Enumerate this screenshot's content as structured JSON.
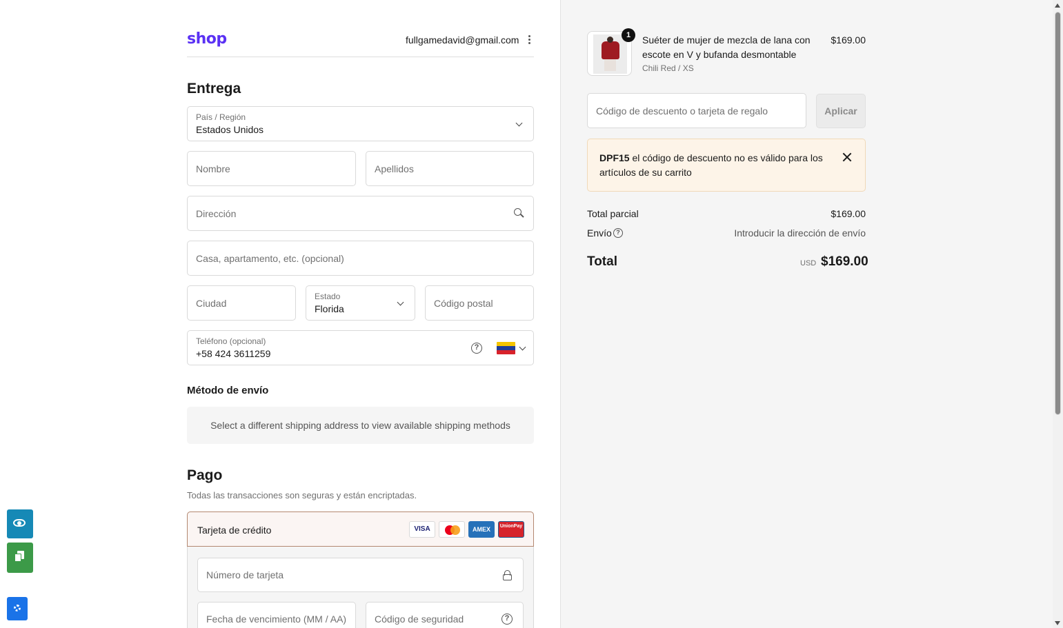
{
  "header": {
    "logo": "shop",
    "email": "fullgamedavid@gmail.com"
  },
  "delivery": {
    "title": "Entrega",
    "country": {
      "label": "País / Región",
      "value": "Estados Unidos"
    },
    "first_name": {
      "placeholder": "Nombre"
    },
    "last_name": {
      "placeholder": "Apellidos"
    },
    "address": {
      "placeholder": "Dirección"
    },
    "apartment": {
      "placeholder": "Casa, apartamento, etc. (opcional)"
    },
    "city": {
      "placeholder": "Ciudad"
    },
    "state": {
      "label": "Estado",
      "value": "Florida"
    },
    "zip": {
      "placeholder": "Código postal"
    },
    "phone": {
      "label": "Teléfono (opcional)",
      "value": "+58 424 3611259",
      "help": "?",
      "flag": "venezuela-flag"
    }
  },
  "shipping": {
    "title": "Método de envío",
    "message": "Select a different shipping address to view available shipping methods"
  },
  "payment": {
    "title": "Pago",
    "subtitle": "Todas las transacciones son seguras y están encriptadas.",
    "method_label": "Tarjeta de crédito",
    "cards": [
      "VISA",
      "mastercard",
      "AMEX",
      "UnionPay"
    ],
    "card_number": {
      "placeholder": "Número de tarjeta"
    },
    "expiry": {
      "placeholder": "Fecha de vencimiento (MM / AA)"
    },
    "cvv": {
      "placeholder": "Código de seguridad",
      "help": "?"
    }
  },
  "summary": {
    "product": {
      "quantity": "1",
      "name": "Suéter de mujer de mezcla de lana con escote en V y bufanda desmontable",
      "variant": "Chili Red / XS",
      "price": "$169.00"
    },
    "discount": {
      "placeholder": "Código de descuento o tarjeta de regalo",
      "apply_label": "Aplicar"
    },
    "alert": {
      "code": "DPF15",
      "message": " el código de descuento no es válido para los artículos de su carrito"
    },
    "subtotal_label": "Total parcial",
    "subtotal_value": "$169.00",
    "shipping_label": "Envío",
    "shipping_help": "?",
    "shipping_value": "Introducir la dirección de envío",
    "total_label": "Total",
    "currency": "USD",
    "total_value": "$169.00"
  },
  "colors": {
    "brand": "#5a31f4",
    "alert_bg": "#fdf4e8",
    "panel_bg": "#f5f5f5"
  }
}
